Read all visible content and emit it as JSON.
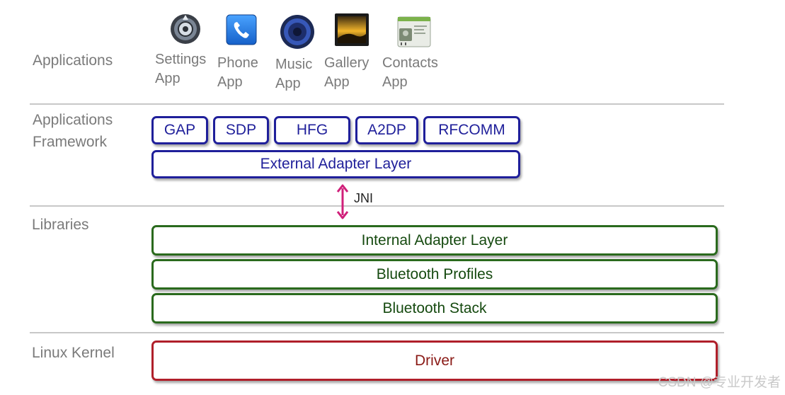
{
  "layers": {
    "applications": "Applications",
    "framework_line1": "Applications",
    "framework_line2": "Framework",
    "libraries": "Libraries",
    "kernel": "Linux Kernel"
  },
  "apps": [
    {
      "label": "Settings\nApp",
      "icon": "settings-icon"
    },
    {
      "label": "Phone\nApp",
      "icon": "phone-icon"
    },
    {
      "label": "Music\nApp",
      "icon": "music-speaker-icon"
    },
    {
      "label": "Gallery\nApp",
      "icon": "gallery-icon"
    },
    {
      "label": "Contacts\nApp",
      "icon": "contacts-icon"
    }
  ],
  "framework": {
    "profiles": [
      "GAP",
      "SDP",
      "HFG",
      "A2DP",
      "RFCOMM"
    ],
    "external_adapter": "External Adapter Layer"
  },
  "jni_label": "JNI",
  "libraries": {
    "internal_adapter": "Internal Adapter Layer",
    "bluetooth_profiles": "Bluetooth Profiles",
    "bluetooth_stack": "Bluetooth Stack"
  },
  "kernel": {
    "driver": "Driver"
  },
  "colors": {
    "framework": "#1f1f9a",
    "libraries": "#2a6a1d",
    "kernel": "#b01f2a",
    "jni_arrow": "#d0207a"
  },
  "watermark": "CSDN @专业开发者"
}
